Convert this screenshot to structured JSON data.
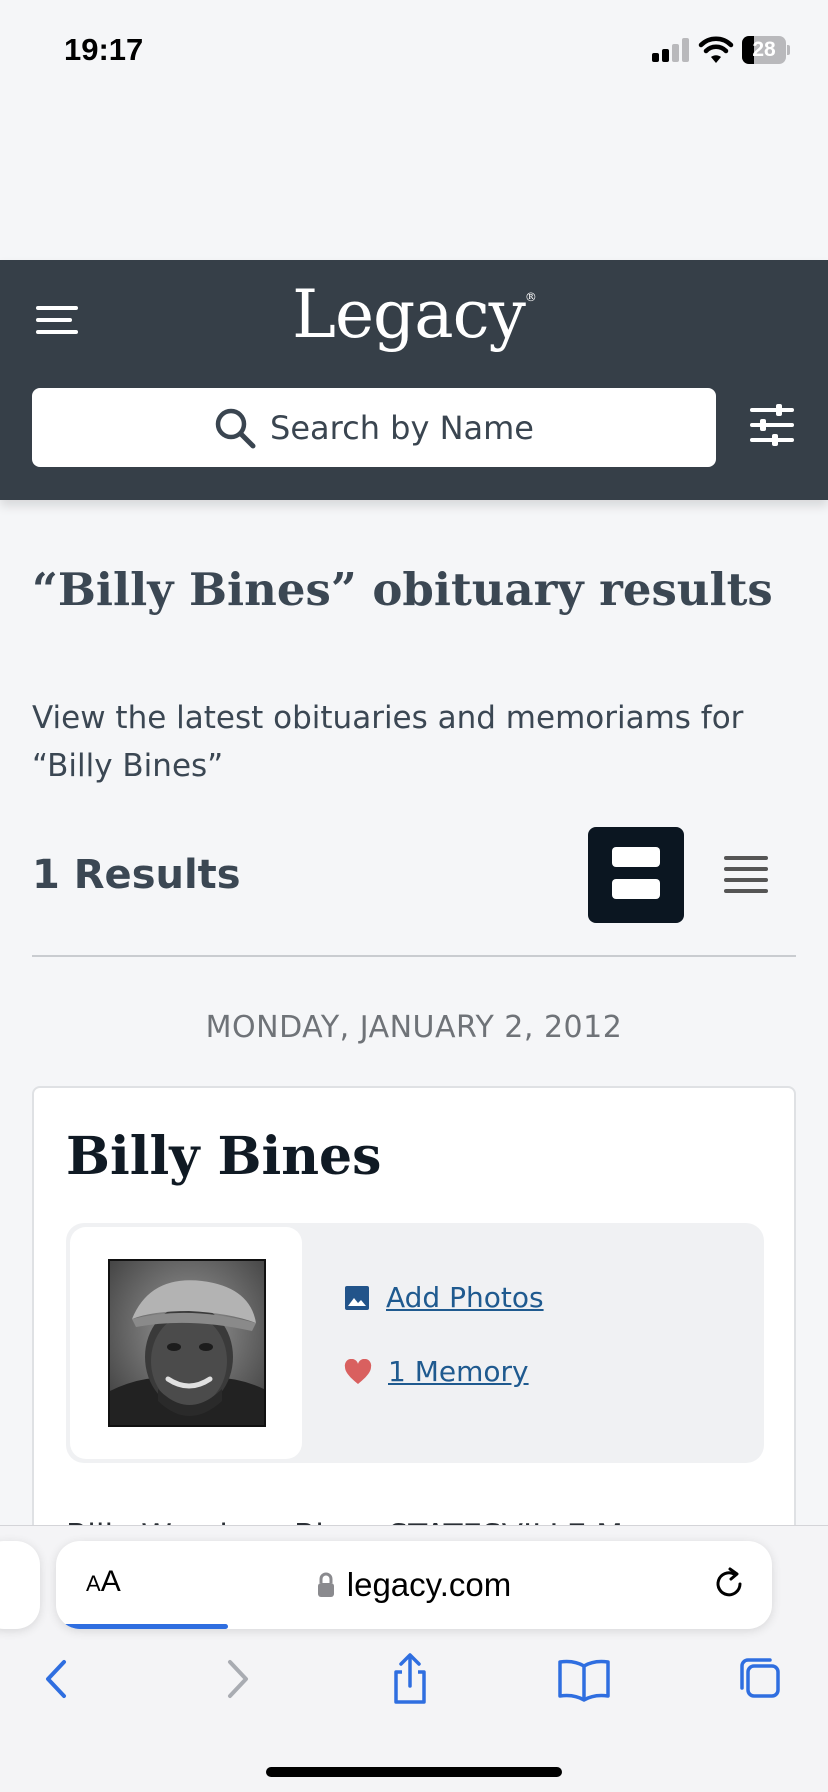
{
  "status_bar": {
    "time": "19:17",
    "battery_level": "28",
    "battery_fraction": 0.28,
    "signal_bars_active": 2,
    "signal_bars_total": 4
  },
  "header": {
    "logo_text": "Legacy",
    "logo_mark": "®",
    "search_placeholder": "Search by Name",
    "background_color": "#363f48"
  },
  "results": {
    "heading": "“Billy Bines” obituary results",
    "description": "View the latest obituaries and memoriams for “Billy Bines”",
    "count_label": "1 Results",
    "view_modes": [
      "card-view",
      "list-view"
    ],
    "active_view": "card-view"
  },
  "obituaries": [
    {
      "date": "MONDAY, JANUARY 2, 2012",
      "name": "Billy Bines",
      "add_photos_label": "Add Photos",
      "memories_label": "1 Memory",
      "snippet": "Billy Woodrow Bines STATESVILLE Mr."
    }
  ],
  "browser": {
    "aa_small": "A",
    "aa_big": "A",
    "url": "legacy.com",
    "load_progress": 0.24,
    "accent_color": "#2f6ee0",
    "toolbar_icons": [
      "back-icon",
      "forward-icon",
      "share-icon",
      "bookmarks-icon",
      "tabs-icon"
    ]
  }
}
